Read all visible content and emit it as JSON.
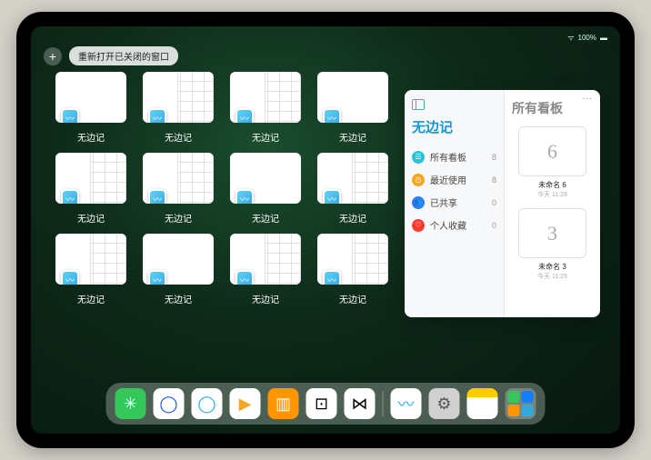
{
  "status": {
    "battery": "100%"
  },
  "pill": {
    "plus": "+",
    "reopen_label": "重新打开已关闭的窗口"
  },
  "app_name": "无边记",
  "thumbs": [
    {
      "label": "无边记",
      "layout": "blank"
    },
    {
      "label": "无边记",
      "layout": "split"
    },
    {
      "label": "无边记",
      "layout": "split"
    },
    {
      "label": "无边记",
      "layout": "blank"
    },
    {
      "label": "无边记",
      "layout": "split"
    },
    {
      "label": "无边记",
      "layout": "split"
    },
    {
      "label": "无边记",
      "layout": "blank"
    },
    {
      "label": "无边记",
      "layout": "split"
    },
    {
      "label": "无边记",
      "layout": "split"
    },
    {
      "label": "无边记",
      "layout": "blank"
    },
    {
      "label": "无边记",
      "layout": "split"
    },
    {
      "label": "无边记",
      "layout": "split"
    }
  ],
  "panel": {
    "left_title": "无边记",
    "right_title": "所有看板",
    "items": [
      {
        "icon_color": "#28c3d9",
        "glyph": "☰",
        "label": "所有看板",
        "count": "8"
      },
      {
        "icon_color": "#f5a623",
        "glyph": "◷",
        "label": "最近使用",
        "count": "8"
      },
      {
        "icon_color": "#2d7ef7",
        "glyph": "👥",
        "label": "已共享",
        "count": "0"
      },
      {
        "icon_color": "#ff3b30",
        "glyph": "♡",
        "label": "个人收藏",
        "count": "0"
      }
    ],
    "boards": [
      {
        "glyph": "6",
        "label": "未命名 6",
        "sub": "今天 11:28"
      },
      {
        "glyph": "3",
        "label": "未命名 3",
        "sub": "今天 11:25"
      }
    ]
  },
  "dock": [
    {
      "bg": "#35c759",
      "name": "wechat-icon",
      "content": "✳"
    },
    {
      "bg": "#ffffff",
      "name": "browser1-icon",
      "content": "◯",
      "fg": "#2255ee"
    },
    {
      "bg": "#ffffff",
      "name": "browser2-icon",
      "content": "◯",
      "fg": "#22aaff"
    },
    {
      "bg": "#ffffff",
      "name": "play-icon",
      "content": "▶",
      "fg": "#f5a623"
    },
    {
      "bg": "#ff9500",
      "name": "books-icon",
      "content": "▥",
      "fg": "#fff"
    },
    {
      "bg": "#ffffff",
      "name": "dice-icon",
      "content": "⊡",
      "fg": "#000"
    },
    {
      "bg": "#ffffff",
      "name": "dumbbell-icon",
      "content": "⋈",
      "fg": "#000"
    }
  ],
  "dock_recent": [
    {
      "bg": "#ffffff",
      "name": "freeform-icon",
      "content": "〰",
      "fg": "#22aaff"
    },
    {
      "bg": "#d0d0d0",
      "name": "settings-icon",
      "content": "⚙",
      "fg": "#555"
    },
    {
      "bg": "#ffffff",
      "name": "notes-icon",
      "content": "",
      "top": "#ffcc00"
    }
  ]
}
